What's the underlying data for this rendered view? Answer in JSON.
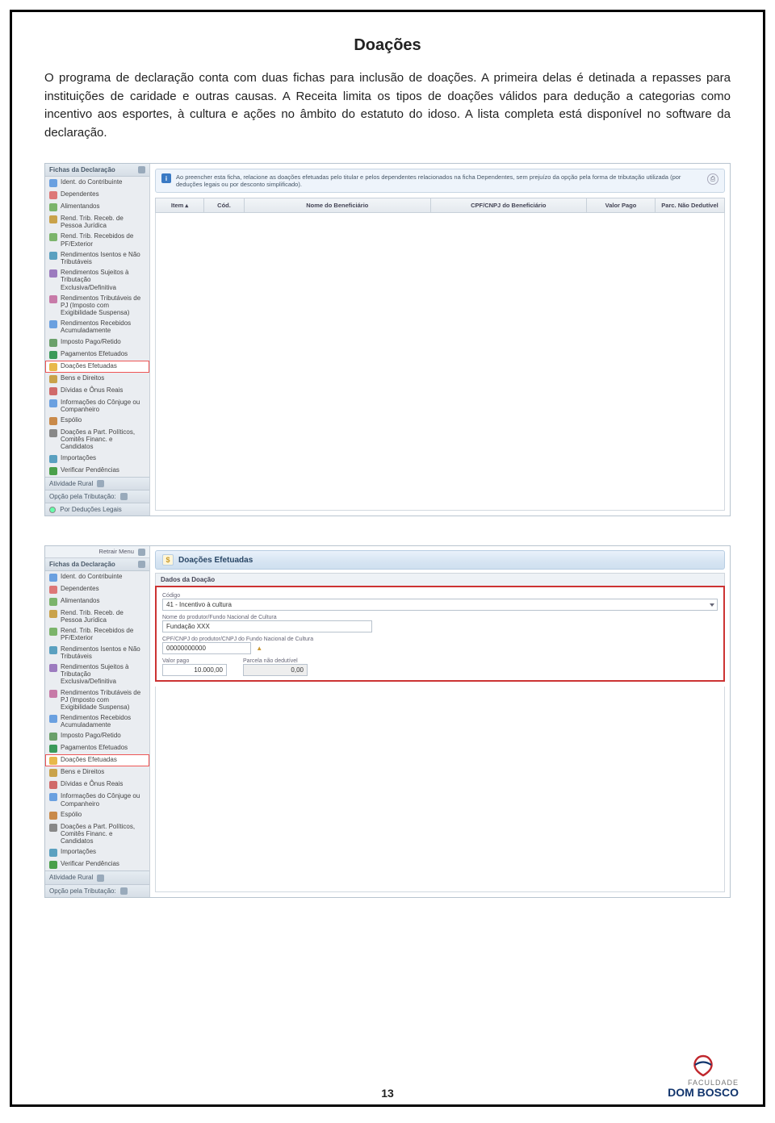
{
  "page": {
    "title": "Doações",
    "body": "O programa de declaração conta com duas fichas para inclusão de doações. A primeira delas é detinada a repasses para instituições de caridade e outras causas. A Receita limita os tipos de doações válidos para dedução a categorias como incentivo aos esportes, à cultura e ações no âmbito do estatuto do idoso. A lista completa está disponível no software da declaração.",
    "number": "13"
  },
  "sidebar": {
    "retrair": "Retrair Menu",
    "header": "Fichas da Declaração",
    "items": [
      {
        "icon": "#6aa0e0",
        "label": "Ident. do Contribuinte"
      },
      {
        "icon": "#d77",
        "label": "Dependentes"
      },
      {
        "icon": "#7bb46b",
        "label": "Alimentandos"
      },
      {
        "icon": "#c9a24a",
        "label": "Rend. Trib. Receb. de Pessoa Jurídica"
      },
      {
        "icon": "#7bb46b",
        "label": "Rend. Trib. Recebidos de PF/Exterior"
      },
      {
        "icon": "#5aa0c0",
        "label": "Rendimentos Isentos e Não Tributáveis"
      },
      {
        "icon": "#9c7bbf",
        "label": "Rendimentos Sujeitos à Tributação Exclusiva/Definitiva"
      },
      {
        "icon": "#c77aa8",
        "label": "Rendimentos Tributáveis de PJ (Imposto com Exigibilidade Suspensa)"
      },
      {
        "icon": "#6aa0e0",
        "label": "Rendimentos Recebidos Acumuladamente"
      },
      {
        "icon": "#6aa06a",
        "label": "Imposto Pago/Retido"
      },
      {
        "icon": "#3a9a5a",
        "label": "Pagamentos Efetuados"
      },
      {
        "icon": "#e8b84a",
        "label": "Doações Efetuadas",
        "highlight": true
      },
      {
        "icon": "#c9a24a",
        "label": "Bens e Direitos"
      },
      {
        "icon": "#d06a6a",
        "label": "Dívidas e Ônus Reais"
      },
      {
        "icon": "#6aa0e0",
        "label": "Informações do Cônjuge ou Companheiro"
      },
      {
        "icon": "#c98a4a",
        "label": "Espólio"
      },
      {
        "icon": "#888",
        "label": "Doações a Part. Políticos, Comitês Financ. e Candidatos"
      },
      {
        "icon": "#5aa0c0",
        "label": "Importações"
      },
      {
        "icon": "#4aa04a",
        "label": "Verificar Pendências"
      }
    ],
    "footer_rural": "Atividade Rural",
    "footer_opcao": "Opção pela Tributação:",
    "footer_deducoes": "Por Deduções Legais"
  },
  "shot1": {
    "info": "Ao preencher esta ficha, relacione as doações efetuadas pelo titular e pelos dependentes relacionados na ficha Dependentes, sem prejuízo da opção pela forma de tributação utilizada (por deduções legais ou por desconto simplificado).",
    "cols": {
      "item": "Item ▴",
      "cod": "Cód.",
      "nome": "Nome do Beneficiário",
      "cpf": "CPF/CNPJ do Beneficiário",
      "valor": "Valor Pago",
      "parc": "Parc. Não Dedutível"
    }
  },
  "shot2": {
    "title": "Doações Efetuadas",
    "section": "Dados da Doação",
    "labels": {
      "codigo": "Código",
      "codigo_val": "41 - Incentivo à cultura",
      "nome": "Nome do produtor/Fundo Nacional de Cultura",
      "nome_val": "Fundação XXX",
      "cpf": "CPF/CNPJ do produtor/CNPJ do Fundo Nacional de Cultura",
      "cpf_val": "00000000000",
      "valor": "Valor pago",
      "valor_val": "10.000,00",
      "parcela": "Parcela não dedutível",
      "parcela_val": "0,00"
    }
  },
  "logo": {
    "faculdade": "FACULDADE",
    "dombosco": "DOM BOSCO"
  }
}
